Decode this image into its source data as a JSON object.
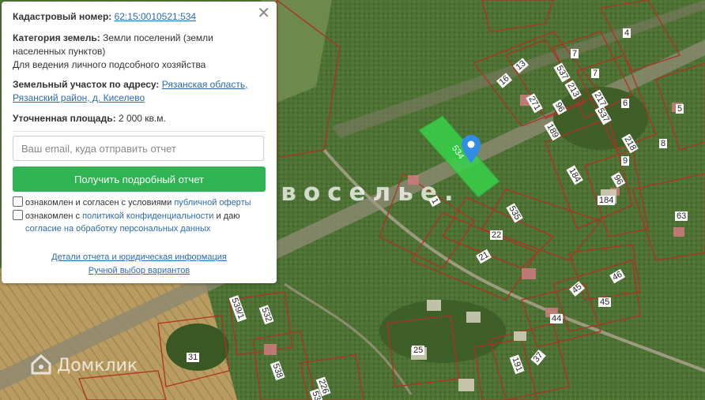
{
  "panel": {
    "cadastral_label": "Кадастровый номер:",
    "cadastral_number": "62:15:0010521:534",
    "category_label": "Категория земель:",
    "category_value": "Земли поселений (земли населенных пунктов)",
    "usage": "Для ведения личного подсобного хозяйства",
    "address_label": "Земельный участок по адресу:",
    "address_value": "Рязанская область, Рязанский район, д. Киселево",
    "area_label": "Уточненная площадь:",
    "area_value": "2 000 кв.м.",
    "email_placeholder": "Ваш email, куда отправить отчет",
    "submit_label": "Получить подробный отчет",
    "consent1_text": "ознакомлен и согласен с условиями",
    "consent1_link": "публичной оферты",
    "consent2_text": "ознакомлен с",
    "consent2_link": "политикой конфиденциальности",
    "consent2_mid": "и даю",
    "consent2_link2": "согласие на обработку персональных данных",
    "details_link": "Детали отчета и юридическая информация",
    "manual_link": "Ручной выбор вариантов",
    "close_icon": "close-icon"
  },
  "map": {
    "selected_plot_label": "534",
    "plot_labels": [
      "4",
      "7",
      "7",
      "13",
      "16",
      "537",
      "213",
      "217",
      "6",
      "5",
      "271",
      "96",
      "537",
      "189",
      "218",
      "8",
      "9",
      "96",
      "184",
      "184",
      "1",
      "535",
      "22",
      "21",
      "63",
      "46",
      "45",
      "45",
      "44",
      "539/1",
      "532",
      "31",
      "25",
      "538",
      "226",
      "37",
      "191",
      "53"
    ],
    "watermark_center": "Новоселье.",
    "watermark_logo": "Домклик",
    "pin_icon": "map-pin-icon",
    "colors": {
      "plot_border": "#c0392b",
      "selected_fill": "#39d24a",
      "pin": "#2f8de4",
      "button": "#2fb353"
    }
  }
}
